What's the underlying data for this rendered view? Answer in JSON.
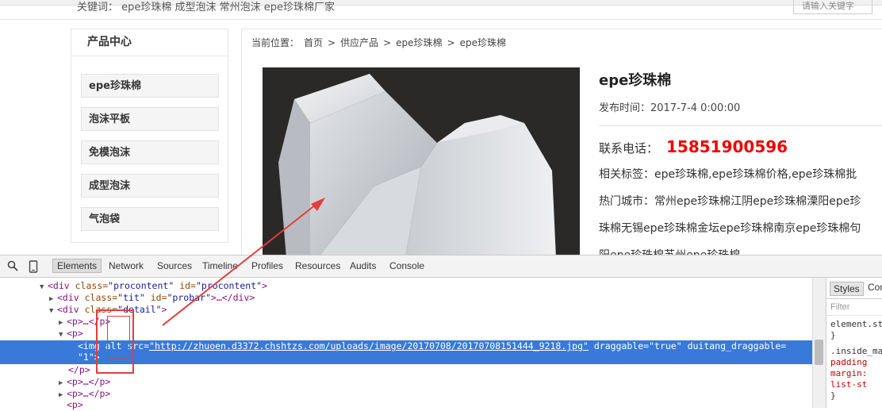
{
  "topbar": {
    "keywords": "关键词：  epe珍珠棉  成型泡沫  常州泡沫  epe珍珠棉厂家",
    "search_placeholder": "请输入关键字"
  },
  "sidebar": {
    "title": "产品中心",
    "items": [
      {
        "label": "epe珍珠棉"
      },
      {
        "label": "泡沫平板"
      },
      {
        "label": "免模泡沫"
      },
      {
        "label": "成型泡沫"
      },
      {
        "label": "气泡袋"
      }
    ]
  },
  "breadcrumb": {
    "prefix": "当前位置：",
    "items": [
      "首页",
      "供应产品",
      "epe珍珠棉",
      "epe珍珠棉"
    ],
    "sep": ">"
  },
  "product": {
    "title": "epe珍珠棉",
    "date": "发布时间：2017-7-4 0:00:00",
    "phone_label": "联系电话：",
    "phone": "15851900596",
    "tags": "相关标签：epe珍珠棉,epe珍珠棉价格,epe珍珠棉批",
    "cities_1": "热门城市：常州epe珍珠棉江阴epe珍珠棉溧阳epe珍",
    "cities_2": "珠棉无锡epe珍珠棉金坛epe珍珠棉南京epe珍珠棉句",
    "cities_3": "阳epe珍珠棉苏州epe珍珠棉"
  },
  "devtools": {
    "tabs": [
      "Elements",
      "Network",
      "Sources",
      "Timeline",
      "Profiles",
      "Resources",
      "Audits",
      "Console"
    ],
    "active_tab": "Elements",
    "dom": {
      "l1_tag": "<div",
      "l1_a1": " class=",
      "l1_v1": "\"procontent\"",
      "l1_a2": " id=",
      "l1_v2": "\"procontent\"",
      "l1_end": ">",
      "l2_open": "<div",
      "l2_a1": " class=",
      "l2_v1": "\"tit\"",
      "l2_a2": " id=",
      "l2_v2": "\"probar\"",
      "l2_end": ">…</div>",
      "l3_open": "<div",
      "l3_a1": " class=",
      "l3_v1": "\"detail\"",
      "l3_end": ">",
      "l4": "<p>…</p>",
      "l5": "<p>",
      "img_tag": "<img",
      "img_alt": " alt",
      "img_src_a": " src=",
      "img_src_v": "\"http://zhuoen.d3372.chshtzs.com/uploads/image/20170708/20170708151444_9218.jpg\"",
      "img_drag_a": " draggable=",
      "img_drag_v": "\"true\"",
      "img_duitang_a": " duitang_draggable=",
      "img_duitang_v": "\"1\"",
      "img_end": ">",
      "l7": "</p>",
      "l8": "<p>…</p>",
      "l9": "<p>…</p>",
      "l10": "<p>"
    },
    "styles": {
      "tab1": "Styles",
      "tab2": "Com",
      "filter": "Filter",
      "lines": [
        "element.st",
        "}",
        ".inside_ma",
        "  padding",
        "  margin:",
        "  list-st",
        "}"
      ]
    }
  },
  "colors": {
    "phone": "#ee0000",
    "selection": "#3879d9",
    "annotation": "#e53c3c"
  }
}
